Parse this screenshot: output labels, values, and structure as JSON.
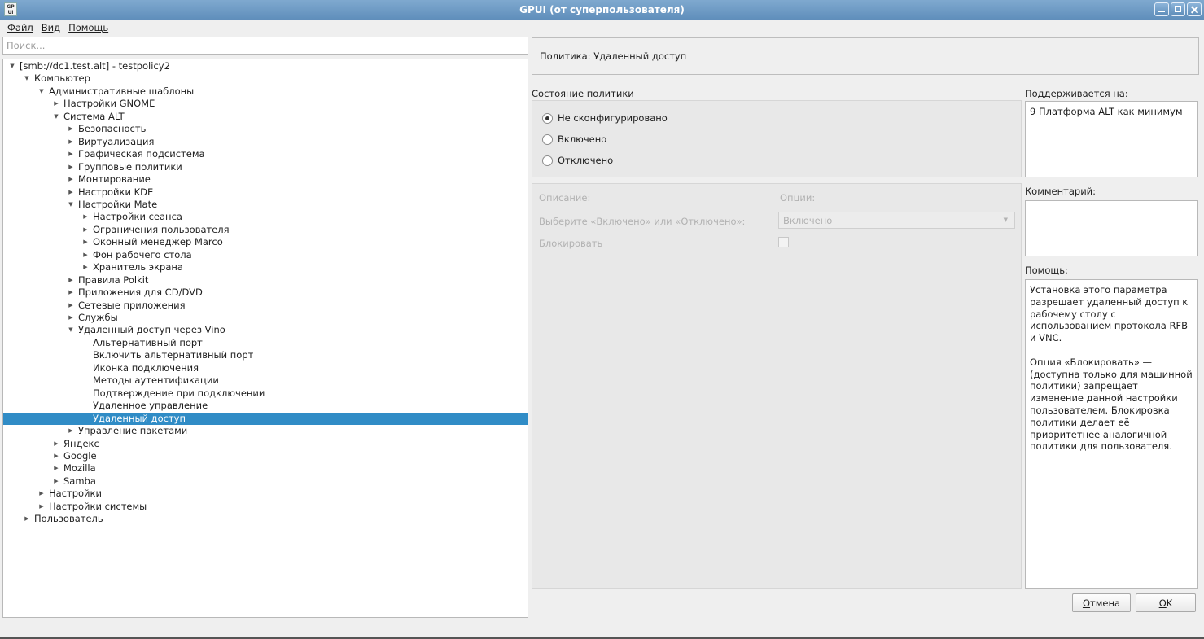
{
  "window": {
    "title": "GPUI (от суперпользователя)",
    "app_icon_text": "GP UI"
  },
  "menubar": [
    {
      "label": "Файл"
    },
    {
      "label": "Вид"
    },
    {
      "label": "Помощь"
    }
  ],
  "search": {
    "placeholder": "Поиск...",
    "value": ""
  },
  "tree": [
    {
      "label": "[smb://dc1.test.alt] - testpolicy2",
      "depth": 0,
      "state": "expanded"
    },
    {
      "label": "Компьютер",
      "depth": 1,
      "state": "expanded"
    },
    {
      "label": "Административные шаблоны",
      "depth": 2,
      "state": "expanded"
    },
    {
      "label": "Настройки GNOME",
      "depth": 3,
      "state": "collapsed"
    },
    {
      "label": "Система ALT",
      "depth": 3,
      "state": "expanded"
    },
    {
      "label": "Безопасность",
      "depth": 4,
      "state": "collapsed"
    },
    {
      "label": "Виртуализация",
      "depth": 4,
      "state": "collapsed"
    },
    {
      "label": "Графическая подсистема",
      "depth": 4,
      "state": "collapsed"
    },
    {
      "label": "Групповые политики",
      "depth": 4,
      "state": "collapsed"
    },
    {
      "label": "Монтирование",
      "depth": 4,
      "state": "collapsed"
    },
    {
      "label": "Настройки KDE",
      "depth": 4,
      "state": "collapsed"
    },
    {
      "label": "Настройки Mate",
      "depth": 4,
      "state": "expanded"
    },
    {
      "label": "Настройки сеанса",
      "depth": 5,
      "state": "collapsed"
    },
    {
      "label": "Ограничения пользователя",
      "depth": 5,
      "state": "collapsed"
    },
    {
      "label": "Оконный менеджер Marco",
      "depth": 5,
      "state": "collapsed"
    },
    {
      "label": "Фон рабочего стола",
      "depth": 5,
      "state": "collapsed"
    },
    {
      "label": "Хранитель экрана",
      "depth": 5,
      "state": "collapsed"
    },
    {
      "label": "Правила Polkit",
      "depth": 4,
      "state": "collapsed"
    },
    {
      "label": "Приложения для CD/DVD",
      "depth": 4,
      "state": "collapsed"
    },
    {
      "label": "Сетевые приложения",
      "depth": 4,
      "state": "collapsed"
    },
    {
      "label": "Службы",
      "depth": 4,
      "state": "collapsed"
    },
    {
      "label": "Удаленный доступ через Vino",
      "depth": 4,
      "state": "expanded"
    },
    {
      "label": "Альтернативный порт",
      "depth": 5,
      "state": "leaf"
    },
    {
      "label": "Включить альтернативный порт",
      "depth": 5,
      "state": "leaf"
    },
    {
      "label": "Иконка подключения",
      "depth": 5,
      "state": "leaf"
    },
    {
      "label": "Методы аутентификации",
      "depth": 5,
      "state": "leaf"
    },
    {
      "label": "Подтверждение при подключении",
      "depth": 5,
      "state": "leaf"
    },
    {
      "label": "Удаленное управление",
      "depth": 5,
      "state": "leaf"
    },
    {
      "label": "Удаленный доступ",
      "depth": 5,
      "state": "leaf",
      "selected": true
    },
    {
      "label": "Управление пакетами",
      "depth": 4,
      "state": "collapsed"
    },
    {
      "label": "Яндекс",
      "depth": 3,
      "state": "collapsed"
    },
    {
      "label": "Google",
      "depth": 3,
      "state": "collapsed"
    },
    {
      "label": "Mozilla",
      "depth": 3,
      "state": "collapsed"
    },
    {
      "label": "Samba",
      "depth": 3,
      "state": "collapsed"
    },
    {
      "label": "Настройки",
      "depth": 2,
      "state": "collapsed"
    },
    {
      "label": "Настройки системы",
      "depth": 2,
      "state": "collapsed"
    },
    {
      "label": "Пользователь",
      "depth": 1,
      "state": "collapsed"
    }
  ],
  "policy": {
    "title": "Политика: Удаленный доступ",
    "state_label": "Состояние политики",
    "states": [
      {
        "label": "Не сконфигурировано",
        "checked": true
      },
      {
        "label": "Включено",
        "checked": false
      },
      {
        "label": "Отключено",
        "checked": false
      }
    ],
    "description_label": "Описание:",
    "options_label": "Опции:",
    "choose_label": "Выберите «Включено» или «Отключено»:",
    "choose_value": "Включено",
    "lock_label": "Блокировать",
    "lock_checked": false
  },
  "side": {
    "supported_label": "Поддерживается на:",
    "supported_text": "9 Платформа ALT как минимум",
    "comment_label": "Комментарий:",
    "comment_text": "",
    "help_label": "Помощь:",
    "help_para1": "Установка этого параметра разрешает удаленный доступ к рабочему столу с использованием протокола RFB и VNC.",
    "help_para2": "Опция «Блокировать» — (доступна только для машинной политики) запрещает изменение данной настройки пользователем. Блокировка политики делает её приоритетнее аналогичной политики для пользователя."
  },
  "buttons": {
    "cancel": "Отмена",
    "ok": "OK"
  }
}
